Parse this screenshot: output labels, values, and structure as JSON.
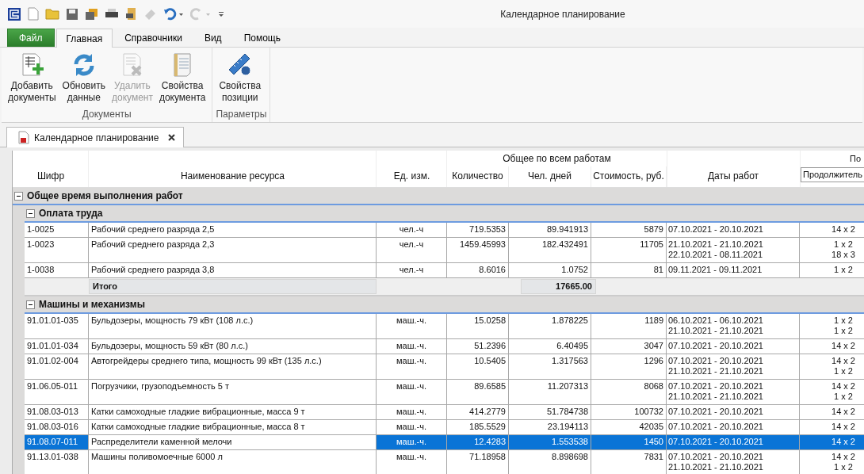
{
  "window": {
    "title": "Календарное планирование"
  },
  "ribbon": {
    "tabs": [
      {
        "label": "Файл",
        "kind": "file",
        "selected": false
      },
      {
        "label": "Главная",
        "kind": "tab",
        "selected": true
      },
      {
        "label": "Справочники",
        "kind": "tab",
        "selected": false
      },
      {
        "label": "Вид",
        "kind": "tab",
        "selected": false
      },
      {
        "label": "Помощь",
        "kind": "tab",
        "selected": false
      }
    ],
    "groups": [
      {
        "label": "Документы",
        "buttons": [
          {
            "lines": [
              "Добавить",
              "документы"
            ],
            "kind": "add",
            "disabled": false
          },
          {
            "lines": [
              "Обновить",
              "данные"
            ],
            "kind": "refresh",
            "disabled": false
          },
          {
            "lines": [
              "Удалить",
              "документ"
            ],
            "kind": "delete",
            "disabled": true
          },
          {
            "lines": [
              "Свойства",
              "документа"
            ],
            "kind": "doc",
            "disabled": false
          }
        ]
      },
      {
        "label": "Параметры",
        "buttons": [
          {
            "lines": [
              "Свойства",
              "позиции"
            ],
            "kind": "ruler",
            "disabled": false
          }
        ]
      }
    ]
  },
  "document_tab": {
    "title": "Календарное планирование"
  },
  "table": {
    "header_group": "Общее по всем работам",
    "header_group_cut": "По",
    "columns": [
      "Шифр",
      "Наименование ресурса",
      "Ед. изм.",
      "Количество",
      "Чел. дней",
      "Стоимость, руб.",
      "Даты работ"
    ],
    "column_editor": "Продолжитель",
    "groups": [
      {
        "title": "Общее время выполнения работ",
        "expanded": true,
        "children": [
          {
            "title": "Оплата труда",
            "expanded": true,
            "rows": [
              {
                "code": "1-0025",
                "name": "Рабочий среднего разряда 2,5",
                "unit": "чел.-ч",
                "quantity": "719.5353",
                "man_days": "89.941913",
                "cost": "5879",
                "dates": [
                  "07.10.2021 - 20.10.2021"
                ],
                "durations": [
                  "14 x 2"
                ],
                "selected": false
              },
              {
                "code": "1-0023",
                "name": "Рабочий среднего разряда 2,3",
                "unit": "чел.-ч",
                "quantity": "1459.45993",
                "man_days": "182.432491",
                "cost": "11705",
                "dates": [
                  "21.10.2021 - 21.10.2021",
                  "22.10.2021 - 08.11.2021"
                ],
                "durations": [
                  "1 x 2",
                  "18 x 3"
                ],
                "selected": false
              },
              {
                "code": "1-0038",
                "name": "Рабочий среднего разряда 3,8",
                "unit": "чел.-ч",
                "quantity": "8.6016",
                "man_days": "1.0752",
                "cost": "81",
                "dates": [
                  "09.11.2021 - 09.11.2021"
                ],
                "durations": [
                  "1 x 2"
                ],
                "selected": false
              }
            ],
            "total": {
              "label": "Итого",
              "value": "17665.00"
            }
          },
          {
            "title": "Машины и механизмы",
            "expanded": true,
            "rows": [
              {
                "code": "91.01.01-035",
                "name": "Бульдозеры, мощность 79 кВт (108 л.с.)",
                "unit": "маш.-ч.",
                "quantity": "15.0258",
                "man_days": "1.878225",
                "cost": "1189",
                "dates": [
                  "06.10.2021 - 06.10.2021",
                  "21.10.2021 - 21.10.2021"
                ],
                "durations": [
                  "1 x 2",
                  "1 x 2"
                ],
                "selected": false
              },
              {
                "code": "91.01.01-034",
                "name": "Бульдозеры, мощность 59 кВт (80 л.с.)",
                "unit": "маш.-ч.",
                "quantity": "51.2396",
                "man_days": "6.40495",
                "cost": "3047",
                "dates": [
                  "07.10.2021 - 20.10.2021"
                ],
                "durations": [
                  "14 x 2"
                ],
                "selected": false
              },
              {
                "code": "91.01.02-004",
                "name": "Автогрейдеры среднего типа, мощность 99 кВт (135 л.с.)",
                "unit": "маш.-ч.",
                "quantity": "10.5405",
                "man_days": "1.317563",
                "cost": "1296",
                "dates": [
                  "07.10.2021 - 20.10.2021",
                  "21.10.2021 - 21.10.2021"
                ],
                "durations": [
                  "14 x 2",
                  "1 x 2"
                ],
                "selected": false
              },
              {
                "code": "91.06.05-011",
                "name": "Погрузчики, грузоподъемность 5 т",
                "unit": "маш.-ч.",
                "quantity": "89.6585",
                "man_days": "11.207313",
                "cost": "8068",
                "dates": [
                  "07.10.2021 - 20.10.2021",
                  "21.10.2021 - 21.10.2021"
                ],
                "durations": [
                  "14 x 2",
                  "1 x 2"
                ],
                "selected": false
              },
              {
                "code": "91.08.03-013",
                "name": "Катки самоходные гладкие вибрационные, масса 9 т",
                "unit": "маш.-ч.",
                "quantity": "414.2779",
                "man_days": "51.784738",
                "cost": "100732",
                "dates": [
                  "07.10.2021 - 20.10.2021"
                ],
                "durations": [
                  "14 x 2"
                ],
                "selected": false
              },
              {
                "code": "91.08.03-016",
                "name": "Катки самоходные гладкие вибрационные, масса 8 т",
                "unit": "маш.-ч.",
                "quantity": "185.5529",
                "man_days": "23.194113",
                "cost": "42035",
                "dates": [
                  "07.10.2021 - 20.10.2021"
                ],
                "durations": [
                  "14 x 2"
                ],
                "selected": false
              },
              {
                "code": "91.08.07-011",
                "name": "Распределители каменной мелочи",
                "unit": "маш.-ч.",
                "quantity": "12.4283",
                "man_days": "1.553538",
                "cost": "1450",
                "dates": [
                  "07.10.2021 - 20.10.2021"
                ],
                "durations": [
                  "14 x 2"
                ],
                "selected": true
              },
              {
                "code": "91.13.01-038",
                "name": "Машины поливомоечные 6000 л",
                "unit": "маш.-ч.",
                "quantity": "71.18958",
                "man_days": "8.898698",
                "cost": "7831",
                "dates": [
                  "07.10.2021 - 20.10.2021",
                  "21.10.2021 - 21.10.2021"
                ],
                "durations": [
                  "14 x 2",
                  "1 x 2"
                ],
                "selected": false
              }
            ]
          }
        ]
      }
    ]
  }
}
